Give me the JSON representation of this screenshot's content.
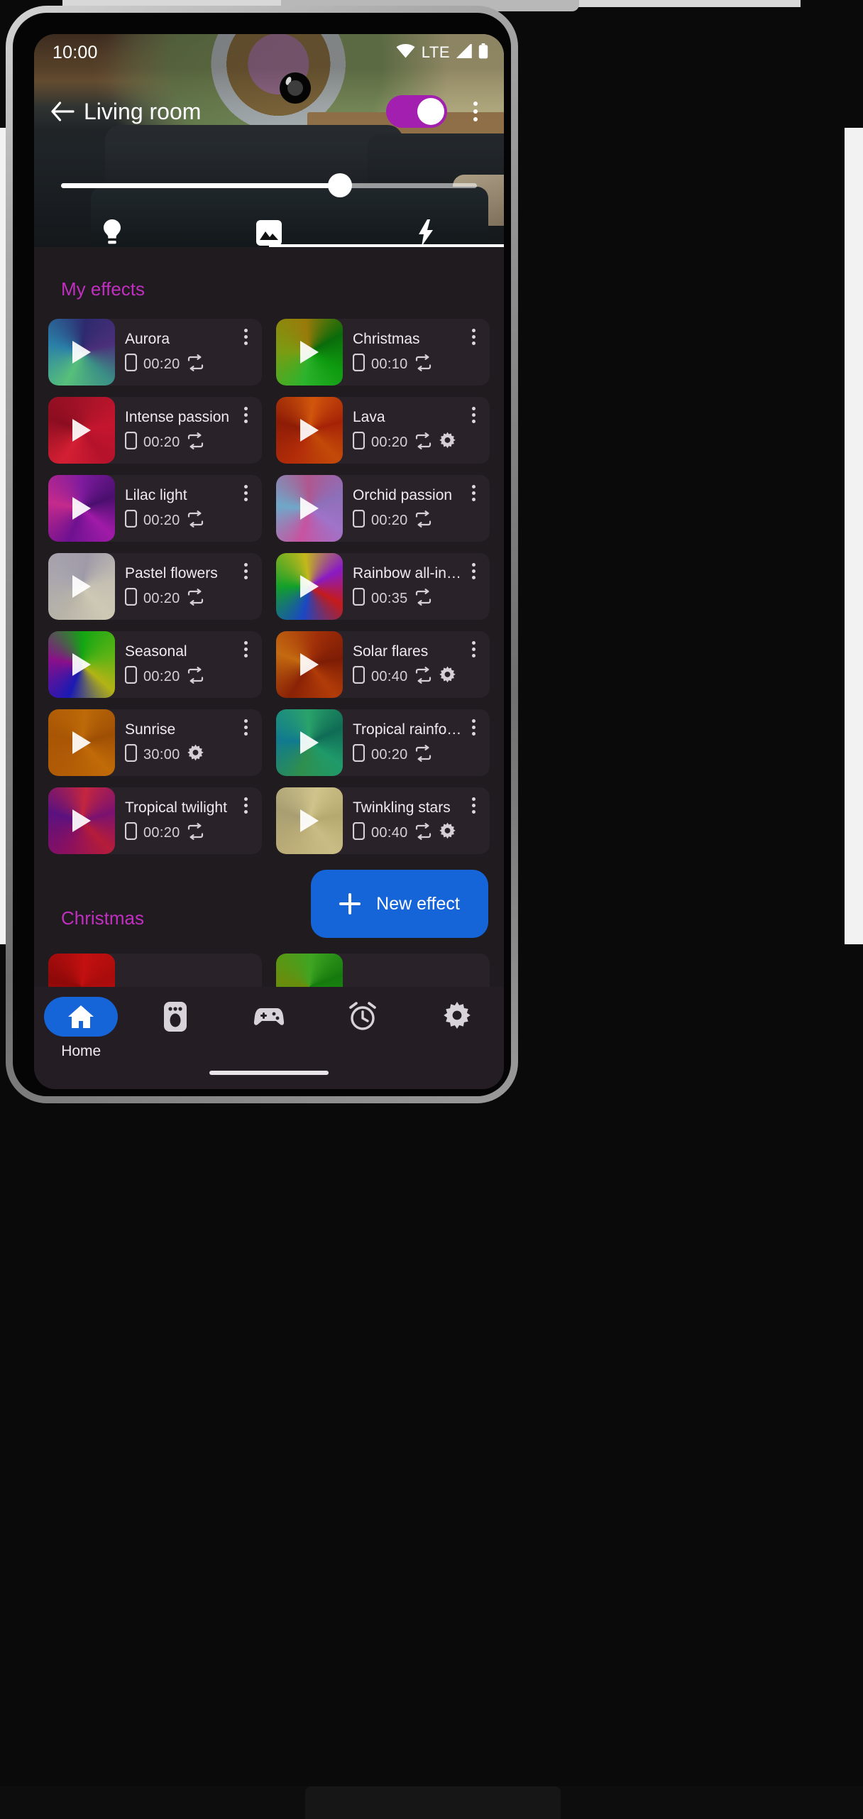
{
  "status_bar": {
    "time": "10:00",
    "icons": [
      "wifi-icon",
      "lte-label",
      "cellular-signal-icon",
      "battery-icon"
    ],
    "lte_label": "LTE"
  },
  "app_bar": {
    "back_icon": "arrow-back-icon",
    "title": "Living room",
    "power_toggle": {
      "state": "on",
      "accent": "#a31fb0"
    },
    "overflow_icon": "more-vertical-icon"
  },
  "brightness_slider": {
    "value_percent": 67,
    "track_color": "#ffffff"
  },
  "hero_actions": [
    {
      "icon": "lightbulb-icon",
      "name": "light-mode-button"
    },
    {
      "icon": "image-icon",
      "name": "scene-picture-button"
    },
    {
      "icon": "bolt-icon",
      "name": "effects-button"
    }
  ],
  "sections": {
    "my_effects_label": "My effects",
    "christmas_label": "Christmas",
    "accent": "#c12fc1"
  },
  "new_effect_button": {
    "label": "New effect",
    "icon": "plus-icon",
    "color": "#1565d8"
  },
  "effects": [
    {
      "name": "Aurora",
      "duration": "00:20",
      "repeat": true,
      "gear": false,
      "thumb": [
        "#3b8f86",
        "#57c07a",
        "#2a7fa8",
        "#2d2a6e",
        "#4b2f7a"
      ],
      "thumb_angle": 135
    },
    {
      "name": "Christmas",
      "duration": "00:10",
      "repeat": true,
      "gear": false,
      "thumb": [
        "#0e9b10",
        "#2db32d",
        "#7a9c12",
        "#9a7a0a",
        "#0a6b0a"
      ],
      "thumb_angle": 120
    },
    {
      "name": "Intense passion",
      "duration": "00:20",
      "repeat": true,
      "gear": false,
      "thumb": [
        "#b5122b",
        "#d41f33",
        "#8c0d20",
        "#a81328",
        "#c4162e"
      ],
      "thumb_angle": 140
    },
    {
      "name": "Lava",
      "duration": "00:20",
      "repeat": true,
      "gear": true,
      "thumb": [
        "#c24a08",
        "#b32d09",
        "#8e1c06",
        "#d1560c",
        "#a62207"
      ],
      "thumb_angle": 135
    },
    {
      "name": "Lilac light",
      "duration": "00:20",
      "repeat": true,
      "gear": false,
      "thumb": [
        "#a01ba8",
        "#6e1191",
        "#c52a8c",
        "#7d1b9e",
        "#4a0f6e"
      ],
      "thumb_angle": 130
    },
    {
      "name": "Orchid passion",
      "duration": "00:20",
      "repeat": true,
      "gear": false,
      "thumb": [
        "#9f73c9",
        "#c7539f",
        "#6fa8c9",
        "#b0578f",
        "#8d6fb8"
      ],
      "thumb_angle": 125
    },
    {
      "name": "Pastel flowers",
      "duration": "00:20",
      "repeat": true,
      "gear": false,
      "thumb": [
        "#cdc9b4",
        "#b9b4a8",
        "#a9a6ae",
        "#9f9aa8",
        "#c4bfb2"
      ],
      "thumb_angle": 140
    },
    {
      "name": "Rainbow all-in-one",
      "duration": "00:35",
      "repeat": true,
      "gear": false,
      "thumb": [
        "#c41b1b",
        "#1b47c4",
        "#12a02a",
        "#c4b81b",
        "#8a1bc4"
      ],
      "thumb_angle": 120
    },
    {
      "name": "Seasonal",
      "duration": "00:20",
      "repeat": true,
      "gear": false,
      "thumb": [
        "#b3b315",
        "#1a1ab3",
        "#8a0f8a",
        "#13a513",
        "#5ab315"
      ],
      "thumb_angle": 130
    },
    {
      "name": "Solar flares",
      "duration": "00:40",
      "repeat": true,
      "gear": true,
      "thumb": [
        "#b23c08",
        "#8a2206",
        "#c46a10",
        "#a13009",
        "#7d1c05"
      ],
      "thumb_angle": 140
    },
    {
      "name": "Sunrise",
      "duration": "30:00",
      "repeat": false,
      "gear": true,
      "thumb": [
        "#c06a08",
        "#b25c06",
        "#a85505",
        "#bd6a09",
        "#9e4f04"
      ],
      "thumb_angle": 135
    },
    {
      "name": "Tropical rainforest",
      "duration": "00:20",
      "repeat": true,
      "gear": false,
      "thumb": [
        "#1f9a6a",
        "#2f8f4e",
        "#117a8f",
        "#2aa36b",
        "#0f6b55"
      ],
      "thumb_angle": 125
    },
    {
      "name": "Tropical twilight",
      "duration": "00:20",
      "repeat": true,
      "gear": false,
      "thumb": [
        "#b51c3a",
        "#8a1060",
        "#5a1180",
        "#c4263f",
        "#7a1270"
      ],
      "thumb_angle": 135
    },
    {
      "name": "Twinkling stars",
      "duration": "00:40",
      "repeat": true,
      "gear": true,
      "thumb": [
        "#c9bd85",
        "#bdae78",
        "#a89e72",
        "#d0c48c",
        "#b5a96f"
      ],
      "thumb_angle": 140
    }
  ],
  "christmas_effects": [
    {
      "name": "",
      "thumb": [
        "#c41010",
        "#a80c0c",
        "#8e0909",
        "#c41010",
        "#a80c0c"
      ],
      "thumb_angle": 135
    },
    {
      "name": "",
      "thumb": [
        "#1d8f10",
        "#2aa019",
        "#6b8c0c",
        "#3fa522",
        "#157a0d"
      ],
      "thumb_angle": 130
    }
  ],
  "bottom_nav": [
    {
      "label": "Home",
      "icon": "home-icon",
      "active": true
    },
    {
      "label": "",
      "icon": "speaker-icon",
      "active": false
    },
    {
      "label": "",
      "icon": "gamepad-icon",
      "active": false
    },
    {
      "label": "",
      "icon": "alarm-icon",
      "active": false
    },
    {
      "label": "",
      "icon": "gear-icon",
      "active": false
    }
  ]
}
